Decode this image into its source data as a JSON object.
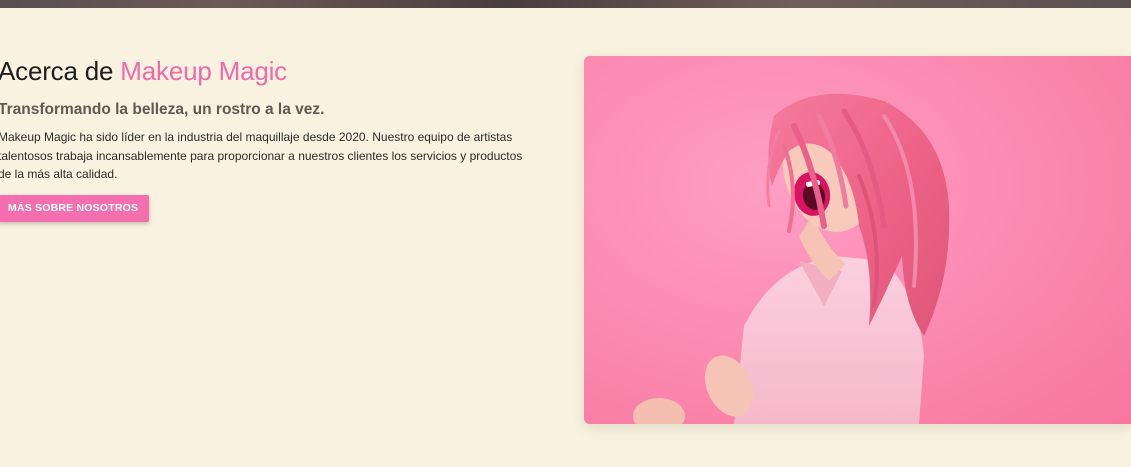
{
  "about": {
    "title_prefix": "Acerca de ",
    "title_accent": "Makeup Magic",
    "subtitle": "Transformando la belleza, un rostro a la vez.",
    "body": "Makeup Magic ha sido líder en la industria del maquillaje desde 2020. Nuestro equipo de artistas talentosos trabaja incansablemente para proporcionar a nuestros clientes los servicios y productos de la más alta calidad.",
    "cta_label": "MÁS SOBRE NOSOTROS"
  },
  "colors": {
    "accent": "#f06aa9",
    "button": "#f56eb0",
    "background": "#faf2e0",
    "photo_background": "#fc8fb6"
  },
  "image": {
    "subject": "woman-with-pink-hair-laughing"
  }
}
